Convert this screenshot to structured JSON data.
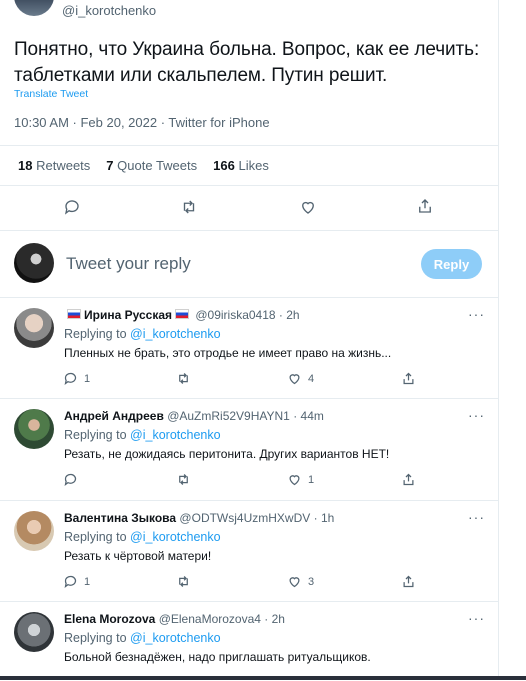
{
  "main_tweet": {
    "handle": "@i_korotchenko",
    "text": "Понятно, что Украина больна. Вопрос, как ее лечить: таблетками или скальпелем. Путин решит.",
    "translate_label": "Translate Tweet",
    "meta": "10:30 AM · Feb 20, 2022 · Twitter for iPhone",
    "stats": {
      "retweets_count": "18",
      "retweets_label": "Retweets",
      "quotes_count": "7",
      "quotes_label": "Quote Tweets",
      "likes_count": "166",
      "likes_label": "Likes"
    }
  },
  "composer": {
    "placeholder": "Tweet your reply",
    "button_label": "Reply"
  },
  "replies": [
    {
      "name": "Ирина Русская",
      "handle": "@09iriska0418",
      "time": "· 2h",
      "replying_prefix": "Replying to",
      "replying_to": "@i_korotchenko",
      "text": "Пленных не брать, это отродье не имеет право на жизнь...",
      "reply_count": "1",
      "retweet_count": "",
      "like_count": "4"
    },
    {
      "name": "Андрей Андреев",
      "handle": "@AuZmRi52V9HAYN1",
      "time": "· 44m",
      "replying_prefix": "Replying to",
      "replying_to": "@i_korotchenko",
      "text": "Резать, не дожидаясь перитонита. Других вариантов НЕТ!",
      "reply_count": "",
      "retweet_count": "",
      "like_count": "1"
    },
    {
      "name": "Валентина Зыкова",
      "handle": "@ODTWsj4UzmHXwDV",
      "time": "· 1h",
      "replying_prefix": "Replying to",
      "replying_to": "@i_korotchenko",
      "text": "Резать к чёртовой матери!",
      "reply_count": "1",
      "retweet_count": "",
      "like_count": "3"
    },
    {
      "name": "Elena Morozova",
      "handle": "@ElenaMorozova4",
      "time": "· 2h",
      "replying_prefix": "Replying to",
      "replying_to": "@i_korotchenko",
      "text": "Больной безнадёжен, надо приглашать ритуальщиков."
    }
  ],
  "colors": {
    "accent": "#1d9bf0",
    "muted": "#536471",
    "reply_button": "#8ecdf8"
  }
}
